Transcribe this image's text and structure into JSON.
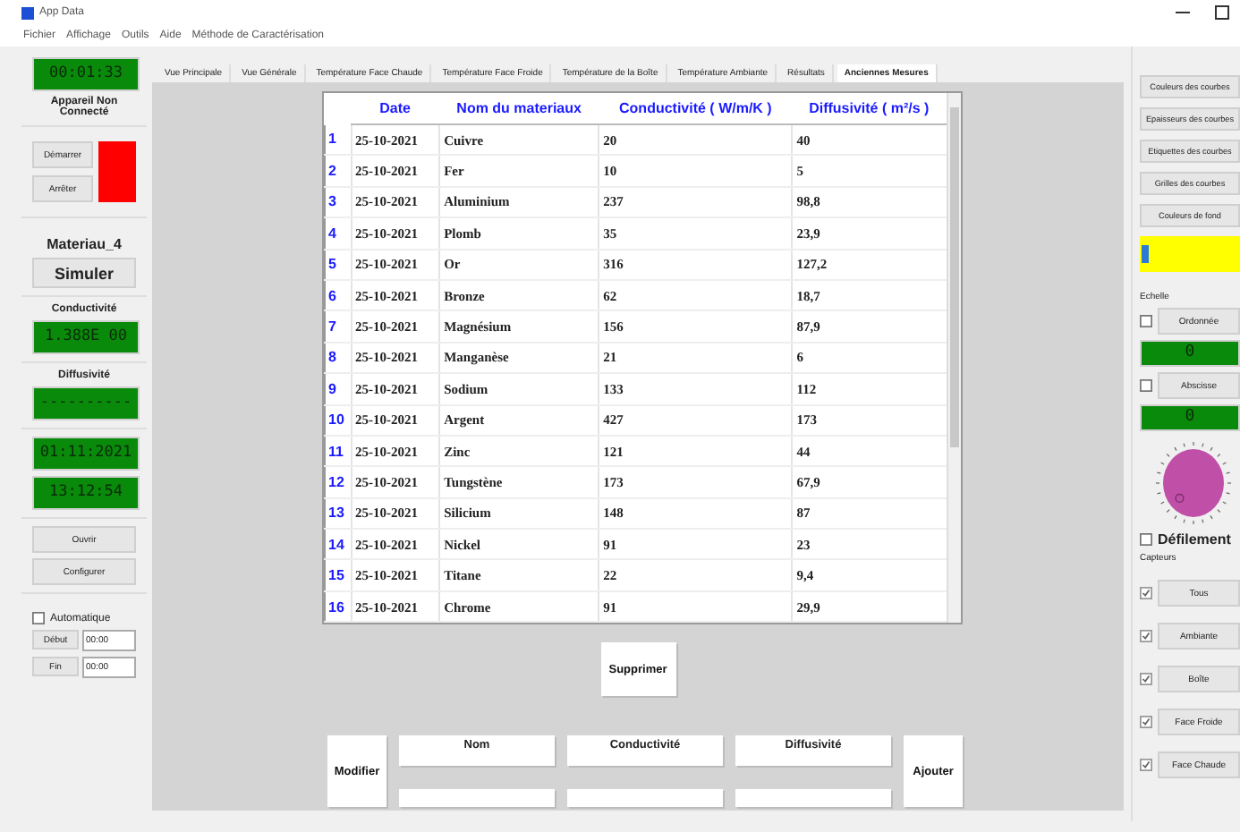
{
  "window": {
    "title": "App Data"
  },
  "menu": [
    "Fichier",
    "Affichage",
    "Outils",
    "Aide",
    "Méthode de Caractérisation"
  ],
  "left_panel": {
    "timer": "00:01:33",
    "status": "Appareil Non Connecté",
    "start": "Démarrer",
    "stop": "Arrêter",
    "connected": false,
    "material": "Materiau_4",
    "simulate": "Simuler",
    "conductivity_label": "Conductivité",
    "conductivity_value": "1.388E 00",
    "diffusivity_label": "Diffusivité",
    "diffusivity_value": "----------",
    "date": "01:11:2021",
    "time": "13:12:54",
    "open": "Ouvrir",
    "configure": "Configurer",
    "automatic": {
      "label": "Automatique",
      "checked": false
    },
    "start_time": {
      "label": "Début",
      "value": "00:00"
    },
    "end_time": {
      "label": "Fin",
      "value": "00:00"
    }
  },
  "tabs": [
    {
      "label": "Vue Principale",
      "selected": false
    },
    {
      "label": "Vue Générale",
      "selected": false
    },
    {
      "label": "Température Face Chaude",
      "selected": false
    },
    {
      "label": "Température Face Froide",
      "selected": false
    },
    {
      "label": "Température de la Boîte",
      "selected": false
    },
    {
      "label": "Température Ambiante",
      "selected": false
    },
    {
      "label": "Résultats",
      "selected": false
    },
    {
      "label": "Anciennes Mesures",
      "selected": true
    }
  ],
  "table": {
    "columns": [
      "Date",
      "Nom du materiaux",
      "Conductivité ( W/m/K )",
      "Diffusivité ( m²/s )"
    ],
    "rows": [
      {
        "num": "1",
        "date": "25-10-2021",
        "name": "Cuivre",
        "conductivity": "20",
        "diffusivity": "40"
      },
      {
        "num": "2",
        "date": "25-10-2021",
        "name": "Fer",
        "conductivity": "10",
        "diffusivity": "5"
      },
      {
        "num": "3",
        "date": "25-10-2021",
        "name": "Aluminium",
        "conductivity": "237",
        "diffusivity": "98,8"
      },
      {
        "num": "4",
        "date": "25-10-2021",
        "name": "Plomb",
        "conductivity": "35",
        "diffusivity": "23,9"
      },
      {
        "num": "5",
        "date": "25-10-2021",
        "name": "Or",
        "conductivity": "316",
        "diffusivity": "127,2"
      },
      {
        "num": "6",
        "date": "25-10-2021",
        "name": "Bronze",
        "conductivity": "62",
        "diffusivity": "18,7"
      },
      {
        "num": "7",
        "date": "25-10-2021",
        "name": "Magnésium",
        "conductivity": "156",
        "diffusivity": "87,9"
      },
      {
        "num": "8",
        "date": "25-10-2021",
        "name": "Manganèse",
        "conductivity": "21",
        "diffusivity": "6"
      },
      {
        "num": "9",
        "date": "25-10-2021",
        "name": "Sodium",
        "conductivity": "133",
        "diffusivity": "112"
      },
      {
        "num": "10",
        "date": "25-10-2021",
        "name": "Argent",
        "conductivity": "427",
        "diffusivity": "173"
      },
      {
        "num": "11",
        "date": "25-10-2021",
        "name": "Zinc",
        "conductivity": "121",
        "diffusivity": "44"
      },
      {
        "num": "12",
        "date": "25-10-2021",
        "name": "Tungstène",
        "conductivity": "173",
        "diffusivity": "67,9"
      },
      {
        "num": "13",
        "date": "25-10-2021",
        "name": "Silicium",
        "conductivity": "148",
        "diffusivity": "87"
      },
      {
        "num": "14",
        "date": "25-10-2021",
        "name": "Nickel",
        "conductivity": "91",
        "diffusivity": "23"
      },
      {
        "num": "15",
        "date": "25-10-2021",
        "name": "Titane",
        "conductivity": "22",
        "diffusivity": "9,4"
      },
      {
        "num": "16",
        "date": "25-10-2021",
        "name": "Chrome",
        "conductivity": "91",
        "diffusivity": "29,9"
      }
    ]
  },
  "delete_button": "Supprimer",
  "editor": {
    "modify": "Modifier",
    "add": "Ajouter",
    "fields": [
      "Nom",
      "Conductivité",
      "Diffusivité"
    ]
  },
  "right_panel": {
    "buttons": [
      "Couleurs des courbes",
      "Epaisseurs des courbes",
      "Etiquettes des courbes",
      "Grilles des courbes",
      "Couleurs de fond"
    ],
    "slider": {
      "level": 0.02
    },
    "scale_label": "Echelle",
    "axes": [
      {
        "label": "Ordonnée",
        "checked": false,
        "value": "0"
      },
      {
        "label": "Abscisse",
        "checked": false,
        "value": "0"
      }
    ],
    "scroll": {
      "label": "Défilement",
      "checked": false
    },
    "sensors_label": "Capteurs",
    "sensors": [
      {
        "label": "Tous",
        "checked": true
      },
      {
        "label": "Ambiante",
        "checked": true
      },
      {
        "label": "Boîte",
        "checked": true
      },
      {
        "label": "Face Froide",
        "checked": true
      },
      {
        "label": "Face Chaude",
        "checked": true
      }
    ]
  }
}
